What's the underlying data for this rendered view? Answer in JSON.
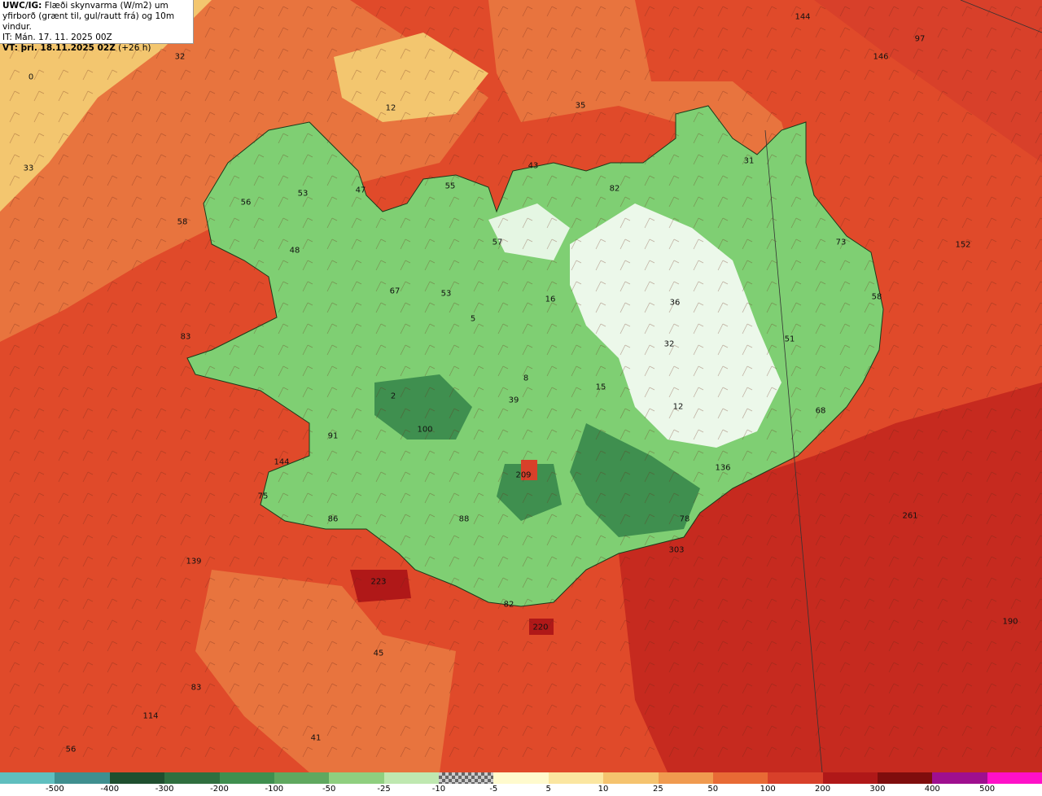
{
  "header": {
    "line1_bold": "UWC/IG:",
    "line1": "Flæði skynvarma (W/m2) um",
    "line2": "yfirborð (grænt til, gul/rautt frá) og 10m vindur.",
    "line3": "IT: Mán. 17. 11. 2025 00Z",
    "line4_bold": "VT: þri. 18.11.2025 02Z",
    "line4": "(+26 h)"
  },
  "map_values": [
    "144",
    "97",
    "146",
    "32",
    "0",
    "12",
    "35",
    "33",
    "43",
    "82",
    "31",
    "55",
    "53",
    "47",
    "56",
    "58",
    "48",
    "57",
    "73",
    "152",
    "67",
    "53",
    "16",
    "36",
    "58",
    "5",
    "32",
    "51",
    "83",
    "8",
    "15",
    "2",
    "39",
    "12",
    "68",
    "91",
    "144",
    "100",
    "75",
    "136",
    "209",
    "86",
    "88",
    "78",
    "261",
    "303",
    "139",
    "223",
    "82",
    "220",
    "190",
    "45",
    "83",
    "114",
    "41",
    "56"
  ],
  "colorbar": {
    "ticks": [
      "-500",
      "-400",
      "-300",
      "-200",
      "-100",
      "-50",
      "-25",
      "-10",
      "-5",
      "5",
      "10",
      "25",
      "50",
      "100",
      "200",
      "300",
      "400",
      "500"
    ],
    "colors": [
      "#5fbfbf",
      "#3f8f8f",
      "#1f4f2f",
      "#2f6f3f",
      "#3f8f4f",
      "#5fa85f",
      "#8fcf7f",
      "#bfe8b0",
      "#999999",
      "#fffacd",
      "#fbe6a0",
      "#f5c36e",
      "#f09a4f",
      "#e86a35",
      "#d8402a",
      "#b01818",
      "#7f0d0d",
      "#9f0f8f",
      "#ff10c8"
    ]
  },
  "colors": {
    "sea_warm": "#e04a2a",
    "sea_hot": "#c62a1f",
    "sea_orange": "#e8743e",
    "sea_yellow": "#f3c66f",
    "land_green": "#7fcf73",
    "land_dark": "#3f8f4f",
    "land_white": "#ffffff"
  }
}
